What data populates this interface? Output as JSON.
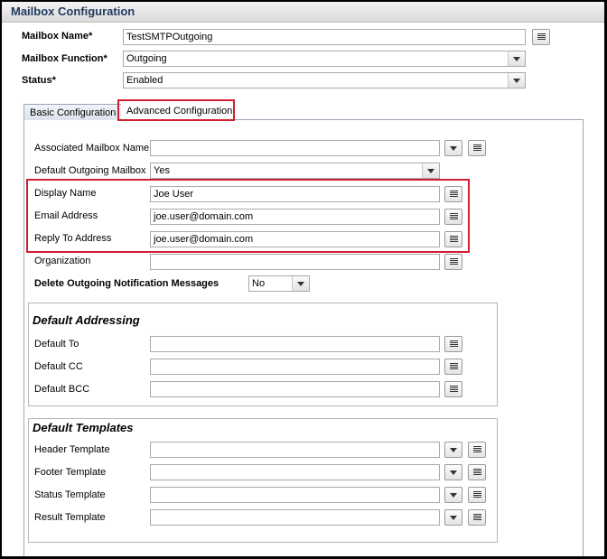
{
  "window": {
    "title": "Mailbox Configuration"
  },
  "header_fields": {
    "mailbox_name": {
      "label": "Mailbox Name*",
      "value": "TestSMTPOutgoing"
    },
    "mailbox_function": {
      "label": "Mailbox Function*",
      "value": "Outgoing"
    },
    "status": {
      "label": "Status*",
      "value": "Enabled"
    }
  },
  "tabs": [
    {
      "label": "Basic Configuration"
    },
    {
      "label": "Advanced Configuration",
      "selected": true
    }
  ],
  "advanced": {
    "associated_mailbox_name": {
      "label": "Associated Mailbox Name",
      "value": ""
    },
    "default_outgoing_mailbox": {
      "label": "Default Outgoing Mailbox",
      "value": "Yes"
    },
    "display_name": {
      "label": "Display Name",
      "value": "Joe User"
    },
    "email_address": {
      "label": "Email Address",
      "value": "joe.user@domain.com"
    },
    "reply_to_address": {
      "label": "Reply To Address",
      "value": "joe.user@domain.com"
    },
    "organization": {
      "label": "Organization",
      "value": ""
    },
    "delete_outgoing_notification": {
      "label": "Delete Outgoing Notification Messages",
      "value": "No"
    }
  },
  "default_addressing": {
    "title": "Default Addressing",
    "to": {
      "label": "Default To",
      "value": ""
    },
    "cc": {
      "label": "Default CC",
      "value": ""
    },
    "bcc": {
      "label": "Default BCC",
      "value": ""
    }
  },
  "default_templates": {
    "title": "Default Templates",
    "header": {
      "label": "Header Template",
      "value": ""
    },
    "footer": {
      "label": "Footer Template",
      "value": ""
    },
    "status": {
      "label": "Status Template",
      "value": ""
    },
    "result": {
      "label": "Result Template",
      "value": ""
    }
  },
  "colors": {
    "highlight": "#d1202f",
    "title_text": "#1e3a5f"
  }
}
